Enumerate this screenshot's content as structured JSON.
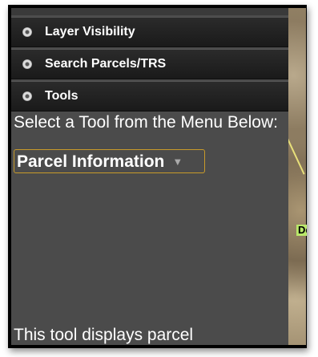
{
  "accordion": {
    "layer_visibility": "Layer Visibility",
    "search_parcels": "Search Parcels/TRS",
    "tools": "Tools"
  },
  "tools": {
    "instruction": "Select a Tool from the Menu Below:",
    "selected_tool": "Parcel Information",
    "description": "This tool displays parcel"
  },
  "map": {
    "label": "De"
  }
}
